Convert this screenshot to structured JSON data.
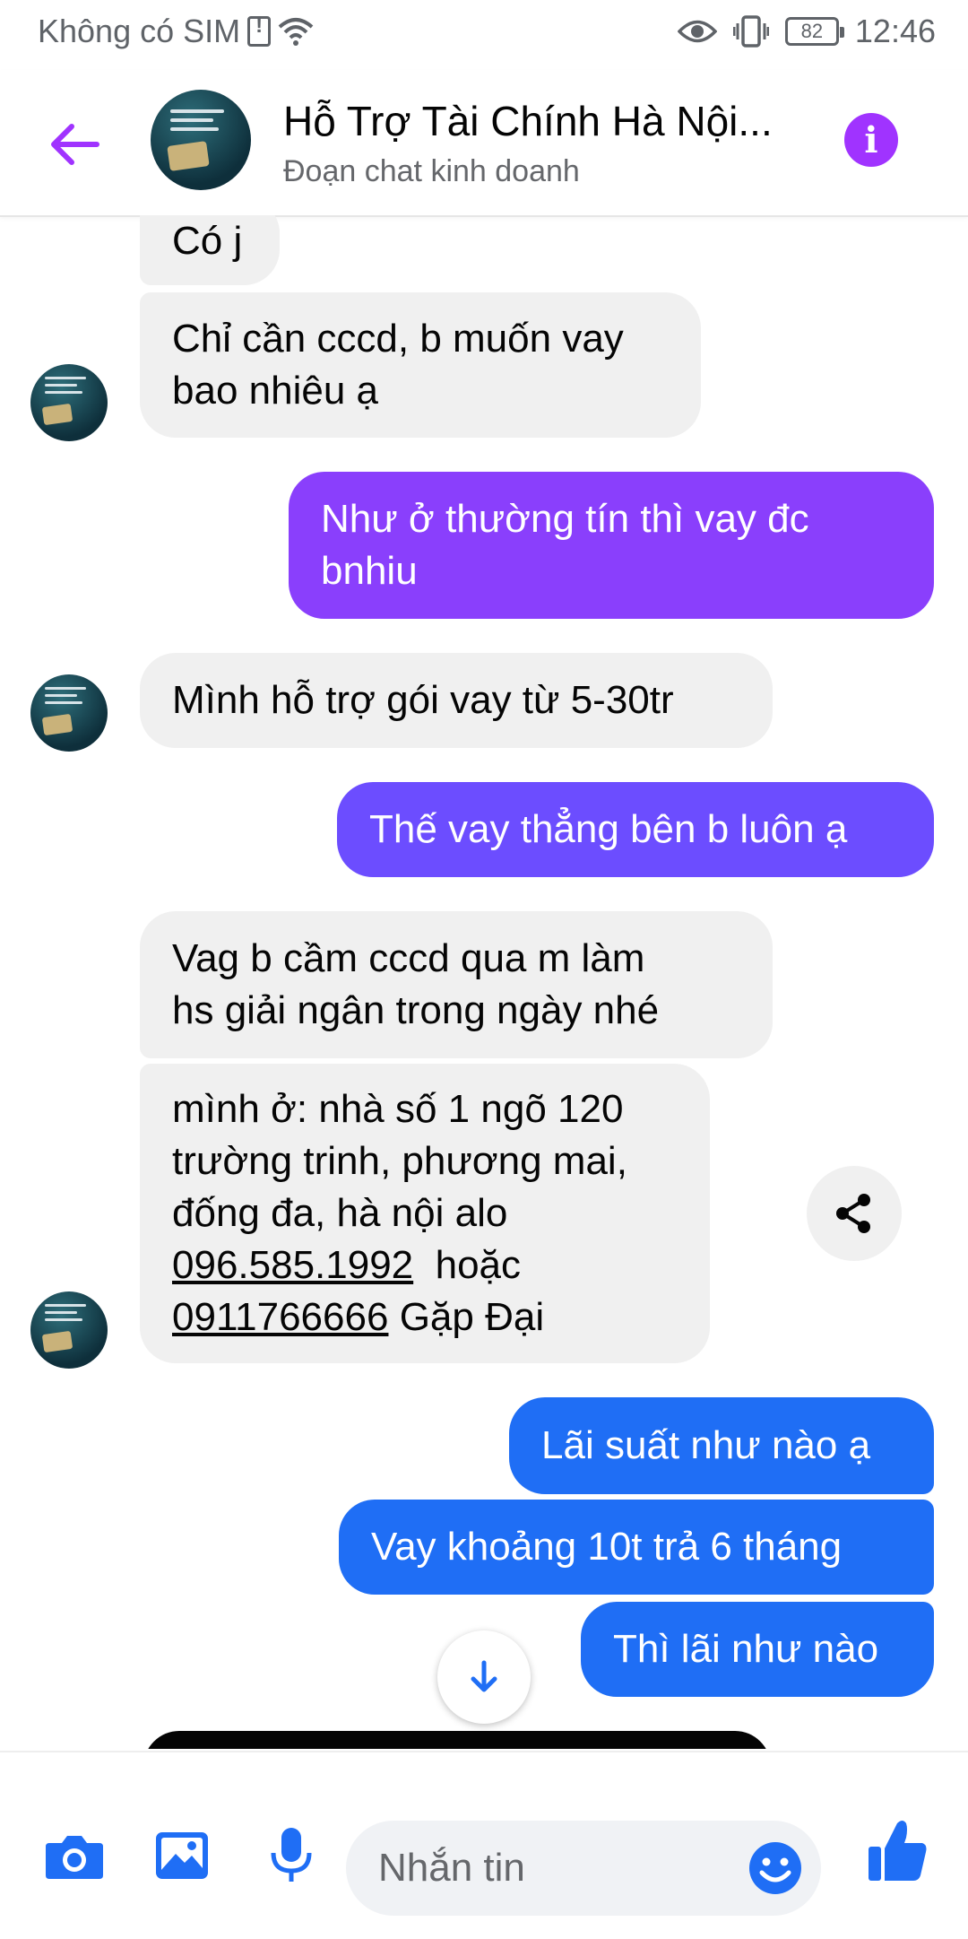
{
  "status_bar": {
    "carrier": "Không có SIM",
    "battery": "82",
    "time": "12:46"
  },
  "header": {
    "title": "Hỗ Trợ Tài Chính Hà Nội...",
    "subtitle": "Đoạn chat kinh doanh"
  },
  "messages": [
    {
      "side": "in",
      "text": "Có j"
    },
    {
      "side": "in",
      "text_lines": [
        "Chỉ cần cccd, b muốn vay",
        "bao nhiêu ạ"
      ]
    },
    {
      "side": "out",
      "text_lines": [
        "Như ở thường tín thì vay đc",
        "bnhiu"
      ]
    },
    {
      "side": "in",
      "text": "Mình hỗ trợ gói vay từ 5-30tr"
    },
    {
      "side": "out",
      "text": "Thế vay thẳng bên b luôn ạ"
    },
    {
      "side": "in",
      "text_lines": [
        "Vag b cầm cccd qua m làm",
        "hs giải ngân trong ngày nhé"
      ]
    },
    {
      "side": "in",
      "text_lines": [
        "mình ở: nhà số 1 ngõ 120",
        "trường trinh, phương mai,",
        "đống đa, hà nội alo"
      ],
      "phone1": "096.585.1992",
      "or_text": "hoặc",
      "phone2": "0911766666",
      "tail": "Gặp Đại"
    },
    {
      "side": "out",
      "text": "Lãi suất như nào ạ"
    },
    {
      "side": "out",
      "text": "Vay khoảng 10t trả 6 tháng"
    },
    {
      "side": "out",
      "text": "Thì lãi như nào"
    }
  ],
  "composer": {
    "placeholder": "Nhắn tin"
  },
  "icons": {
    "back": "back-arrow-icon",
    "info": "info-icon",
    "share": "share-icon",
    "scroll": "arrow-down-icon",
    "camera": "camera-icon",
    "gallery": "image-icon",
    "mic": "microphone-icon",
    "emoji": "emoji-icon",
    "like": "thumbs-up-icon"
  },
  "colors": {
    "accent": "#a033ff",
    "composer_blue": "#1f6ef5"
  }
}
